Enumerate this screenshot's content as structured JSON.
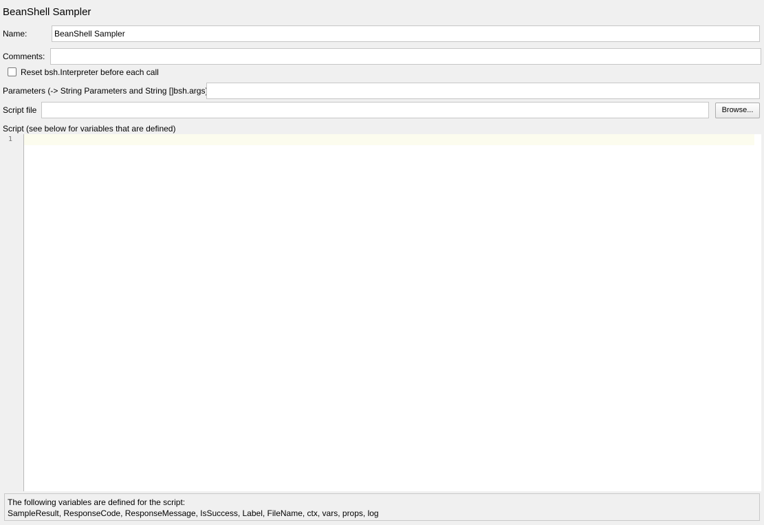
{
  "panel": {
    "title": "BeanShell Sampler"
  },
  "name": {
    "label": "Name:",
    "value": "BeanShell Sampler"
  },
  "comments": {
    "label": "Comments:",
    "value": ""
  },
  "reset_interpreter": {
    "label": "Reset bsh.Interpreter before each call",
    "checked": false
  },
  "parameters": {
    "label": "Parameters (-> String Parameters and String []bsh.args)",
    "value": ""
  },
  "script_file": {
    "label": "Script file",
    "value": "",
    "browse_label": "Browse..."
  },
  "script": {
    "label": "Script (see below for variables that are defined)",
    "line_numbers": [
      "1"
    ],
    "content": ""
  },
  "footer": {
    "line1": "The following variables are defined for the script:",
    "line2": "SampleResult, ResponseCode, ResponseMessage, IsSuccess, Label, FileName, ctx, vars, props, log"
  }
}
